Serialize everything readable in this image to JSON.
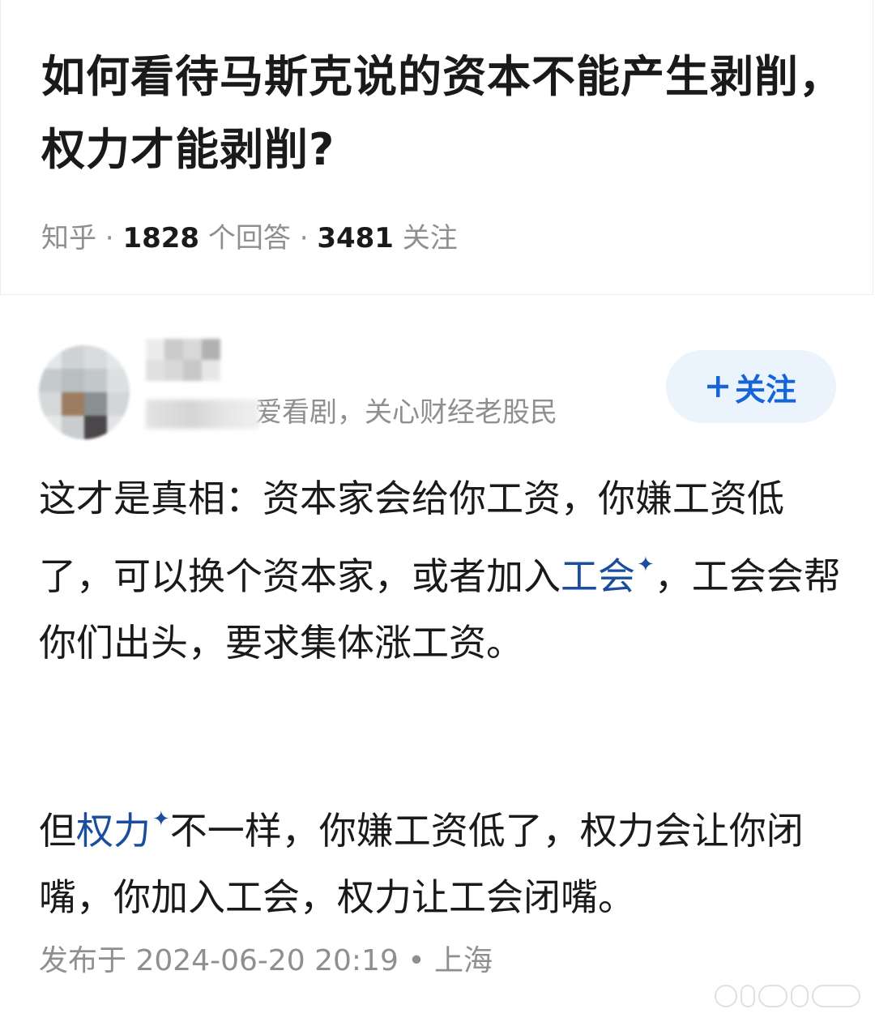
{
  "question": {
    "title": "如何看待马斯克说的资本不能产生剥削，权力才能剥削?",
    "source": "知乎",
    "answer_count": "1828",
    "answer_label": "个回答",
    "follow_count": "3481",
    "follow_label": "关注"
  },
  "author": {
    "bio_visible": "爱看剧，关心财经老股民",
    "follow_button_label": "关注",
    "follow_button_icon": "plus-icon"
  },
  "answer": {
    "paragraph1_a": "这才是真相：资本家会给你工资，你嫌工资低了，可以换个资本家，或者加入",
    "paragraph1_link": "工会",
    "paragraph1_b": "，工会会帮你们出头，要求集体涨工资。",
    "paragraph2_a": "但",
    "paragraph2_link": "权力",
    "paragraph2_b": "不一样，你嫌工资低了，权力会让你闭嘴，你加入工会，权力让工会闭嘴。",
    "spark_glyph": "✦"
  },
  "publish": {
    "label": "发布于",
    "datetime": "2024-06-20 20:19",
    "location": "上海"
  },
  "colors": {
    "accent": "#1565d8",
    "link": "#1a4e9c",
    "meta": "#8f8f8f",
    "follow_bg": "#ebf3fd"
  }
}
